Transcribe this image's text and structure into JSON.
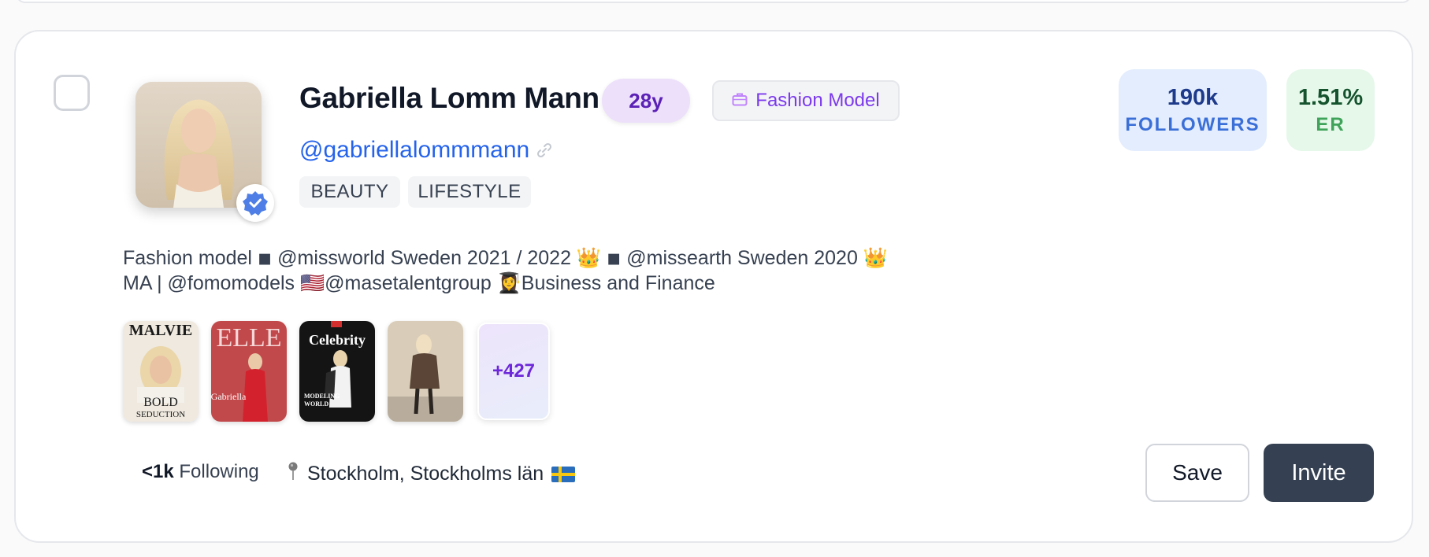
{
  "profile": {
    "name": "Gabriella Lomm Mann",
    "age": "28y",
    "role": "Fashion Model",
    "handle": "@gabriellalommmann",
    "tags": [
      "BEAUTY",
      "LIFESTYLE"
    ],
    "verified": true,
    "bio": "Fashion model ◾ @missworld Sweden 2021 / 2022 👑 ◾ @missearth Sweden 2020 👑\nMA | @fomomodels 🇺🇸@masetalentgroup 👩‍🎓Business and Finance"
  },
  "stats": {
    "followers_value": "190k",
    "followers_label": "FOLLOWERS",
    "er_value": "1.51%",
    "er_label": "ER"
  },
  "media": {
    "thumbs": [
      {
        "title": "MALVIE",
        "line1": "BOLD",
        "line2": "SEDUCTION"
      },
      {
        "title": "ELLE",
        "line1": "Gabriella"
      },
      {
        "title": "Celebrity",
        "line1": "MODELING",
        "line2": "WORLD"
      },
      {
        "title": ""
      }
    ],
    "more_count": "+427"
  },
  "footer": {
    "following_value": "<1k",
    "following_label": "Following",
    "location": "Stockholm, Stockholms län"
  },
  "actions": {
    "save_label": "Save",
    "invite_label": "Invite"
  },
  "colors": {
    "accent_purple": "#7c3aed",
    "handle_blue": "#2563eb",
    "invite_bg": "#354152"
  }
}
